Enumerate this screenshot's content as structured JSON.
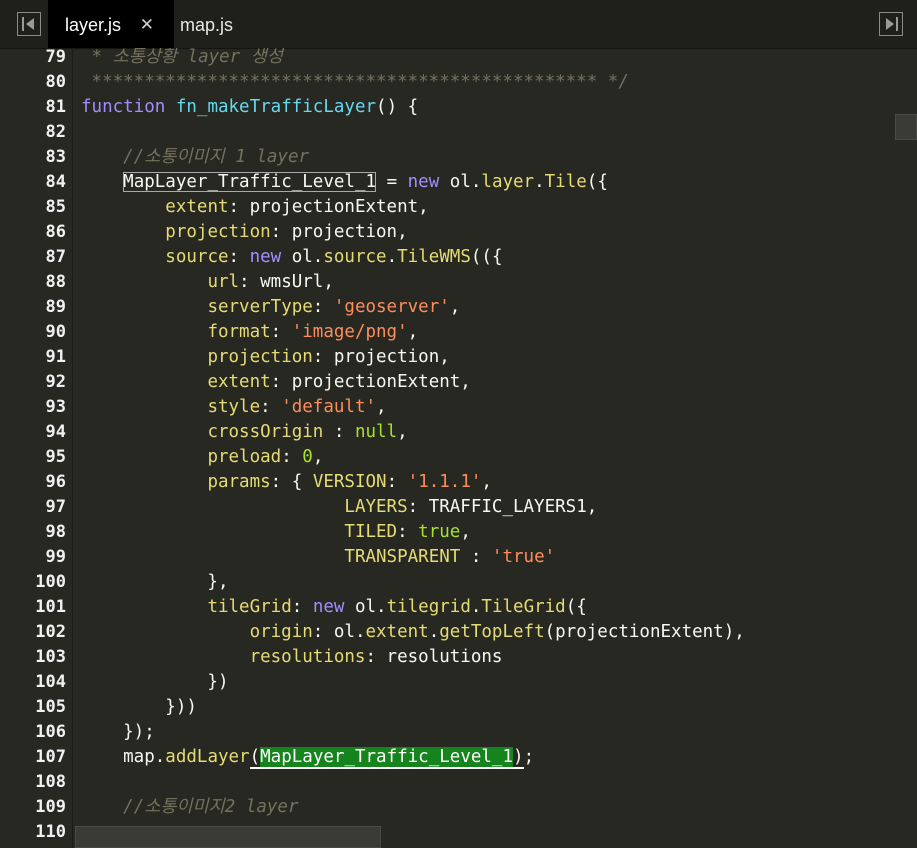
{
  "tabs": [
    {
      "label": "layer.js",
      "close": "✕"
    },
    {
      "label": "map.js"
    }
  ],
  "icons": {
    "prev": "tab-scroll-left-icon",
    "next": "tab-scroll-right-icon"
  },
  "editor": {
    "lines": [
      {
        "num": "79",
        "segs": [
          {
            "t": " * 소통상황 layer 생성",
            "c": "c"
          }
        ]
      },
      {
        "num": "80",
        "segs": [
          {
            "t": " ************************************************ */",
            "c": "c"
          }
        ]
      },
      {
        "num": "81",
        "segs": [
          {
            "t": "function",
            "c": "k"
          },
          {
            "t": " "
          },
          {
            "t": "fn_makeTrafficLayer",
            "c": "fn"
          },
          {
            "t": "() {"
          }
        ]
      },
      {
        "num": "82",
        "segs": []
      },
      {
        "num": "83",
        "segs": [
          {
            "t": "    "
          },
          {
            "t": "//소통이미지 1 layer",
            "c": "c"
          }
        ]
      },
      {
        "num": "84",
        "segs": [
          {
            "t": "    "
          },
          {
            "t": "MapLayer_Traffic_Level_1",
            "c": "box"
          },
          {
            "t": " = "
          },
          {
            "t": "new",
            "c": "k"
          },
          {
            "t": " ol."
          },
          {
            "t": "layer",
            "c": "p"
          },
          {
            "t": "."
          },
          {
            "t": "Tile",
            "c": "p"
          },
          {
            "t": "({"
          }
        ]
      },
      {
        "num": "85",
        "segs": [
          {
            "t": "        "
          },
          {
            "t": "extent",
            "c": "p"
          },
          {
            "t": ": projectionExtent,"
          }
        ]
      },
      {
        "num": "86",
        "segs": [
          {
            "t": "        "
          },
          {
            "t": "projection",
            "c": "p"
          },
          {
            "t": ": projection,"
          }
        ]
      },
      {
        "num": "87",
        "segs": [
          {
            "t": "        "
          },
          {
            "t": "source",
            "c": "p"
          },
          {
            "t": ": "
          },
          {
            "t": "new",
            "c": "k"
          },
          {
            "t": " ol."
          },
          {
            "t": "source",
            "c": "p"
          },
          {
            "t": "."
          },
          {
            "t": "TileWMS",
            "c": "p"
          },
          {
            "t": "(({"
          }
        ]
      },
      {
        "num": "88",
        "segs": [
          {
            "t": "            "
          },
          {
            "t": "url",
            "c": "p"
          },
          {
            "t": ": wmsUrl,"
          }
        ]
      },
      {
        "num": "89",
        "segs": [
          {
            "t": "            "
          },
          {
            "t": "serverType",
            "c": "p"
          },
          {
            "t": ": "
          },
          {
            "t": "'geoserver'",
            "c": "s"
          },
          {
            "t": ","
          }
        ]
      },
      {
        "num": "90",
        "segs": [
          {
            "t": "            "
          },
          {
            "t": "format",
            "c": "p"
          },
          {
            "t": ": "
          },
          {
            "t": "'image/png'",
            "c": "s"
          },
          {
            "t": ","
          }
        ]
      },
      {
        "num": "91",
        "segs": [
          {
            "t": "            "
          },
          {
            "t": "projection",
            "c": "p"
          },
          {
            "t": ": projection,"
          }
        ]
      },
      {
        "num": "92",
        "segs": [
          {
            "t": "            "
          },
          {
            "t": "extent",
            "c": "p"
          },
          {
            "t": ": projectionExtent,"
          }
        ]
      },
      {
        "num": "93",
        "segs": [
          {
            "t": "            "
          },
          {
            "t": "style",
            "c": "p"
          },
          {
            "t": ": "
          },
          {
            "t": "'default'",
            "c": "s"
          },
          {
            "t": ","
          }
        ]
      },
      {
        "num": "94",
        "segs": [
          {
            "t": "            "
          },
          {
            "t": "crossOrigin",
            "c": "p"
          },
          {
            "t": " : "
          },
          {
            "t": "null",
            "c": "n"
          },
          {
            "t": ","
          }
        ]
      },
      {
        "num": "95",
        "segs": [
          {
            "t": "            "
          },
          {
            "t": "preload",
            "c": "p"
          },
          {
            "t": ": "
          },
          {
            "t": "0",
            "c": "n"
          },
          {
            "t": ","
          }
        ]
      },
      {
        "num": "96",
        "segs": [
          {
            "t": "            "
          },
          {
            "t": "params",
            "c": "p"
          },
          {
            "t": ": { "
          },
          {
            "t": "VERSION",
            "c": "p"
          },
          {
            "t": ": "
          },
          {
            "t": "'1.1.1'",
            "c": "s"
          },
          {
            "t": ","
          }
        ]
      },
      {
        "num": "97",
        "segs": [
          {
            "t": "                         "
          },
          {
            "t": "LAYERS",
            "c": "p"
          },
          {
            "t": ": TRAFFIC_LAYERS1,"
          }
        ]
      },
      {
        "num": "98",
        "segs": [
          {
            "t": "                         "
          },
          {
            "t": "TILED",
            "c": "p"
          },
          {
            "t": ": "
          },
          {
            "t": "true",
            "c": "n"
          },
          {
            "t": ","
          }
        ]
      },
      {
        "num": "99",
        "segs": [
          {
            "t": "                         "
          },
          {
            "t": "TRANSPARENT",
            "c": "p"
          },
          {
            "t": " : "
          },
          {
            "t": "'true'",
            "c": "s"
          }
        ]
      },
      {
        "num": "100",
        "segs": [
          {
            "t": "            },"
          }
        ]
      },
      {
        "num": "101",
        "segs": [
          {
            "t": "            "
          },
          {
            "t": "tileGrid",
            "c": "p"
          },
          {
            "t": ": "
          },
          {
            "t": "new",
            "c": "k"
          },
          {
            "t": " ol."
          },
          {
            "t": "tilegrid",
            "c": "p"
          },
          {
            "t": "."
          },
          {
            "t": "TileGrid",
            "c": "p"
          },
          {
            "t": "({"
          }
        ]
      },
      {
        "num": "102",
        "segs": [
          {
            "t": "                "
          },
          {
            "t": "origin",
            "c": "p"
          },
          {
            "t": ": ol."
          },
          {
            "t": "extent",
            "c": "p"
          },
          {
            "t": "."
          },
          {
            "t": "getTopLeft",
            "c": "p"
          },
          {
            "t": "(projectionExtent),"
          }
        ]
      },
      {
        "num": "103",
        "segs": [
          {
            "t": "                "
          },
          {
            "t": "resolutions",
            "c": "p"
          },
          {
            "t": ": resolutions"
          }
        ]
      },
      {
        "num": "104",
        "segs": [
          {
            "t": "            })"
          }
        ]
      },
      {
        "num": "105",
        "segs": [
          {
            "t": "        }))"
          }
        ]
      },
      {
        "num": "106",
        "segs": [
          {
            "t": "    });"
          }
        ]
      },
      {
        "num": "107",
        "segs": [
          {
            "t": "    map."
          },
          {
            "t": "addLayer",
            "c": "p"
          },
          {
            "t": "(",
            "c": "under"
          },
          {
            "t": "MapLayer_Traffic_Level_1",
            "c": "hl"
          },
          {
            "t": ")",
            "c": "under"
          },
          {
            "t": ";"
          }
        ]
      },
      {
        "num": "108",
        "segs": []
      },
      {
        "num": "109",
        "segs": [
          {
            "t": "    "
          },
          {
            "t": "//소통이미지2 layer",
            "c": "c"
          }
        ]
      },
      {
        "num": "110",
        "segs": [
          {
            "t": ""
          }
        ]
      }
    ]
  }
}
